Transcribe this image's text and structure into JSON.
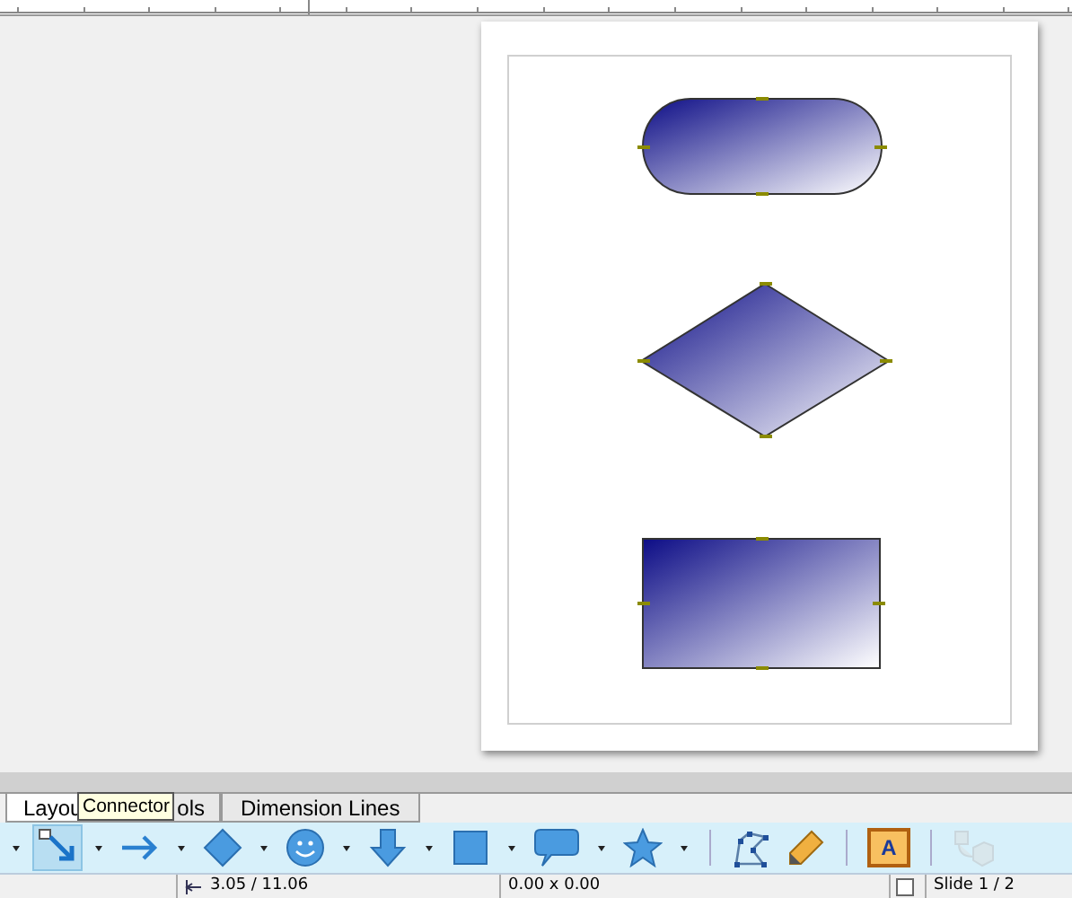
{
  "slide": {
    "shapes": [
      {
        "kind": "rounded"
      },
      {
        "kind": "diamond"
      },
      {
        "kind": "rectangle"
      }
    ]
  },
  "tabs": [
    {
      "label": "Layou",
      "selected": true
    },
    {
      "label": "ols",
      "selected": false
    },
    {
      "label": "Dimension Lines",
      "selected": false
    }
  ],
  "tooltip": "Connector",
  "toolbar": [
    {
      "kind": "connector",
      "selected": true,
      "disabled": false,
      "dropdown": true
    },
    {
      "kind": "arrow",
      "selected": false,
      "disabled": false,
      "dropdown": true
    },
    {
      "kind": "diamond",
      "selected": false,
      "disabled": false,
      "dropdown": true
    },
    {
      "kind": "smiley",
      "selected": false,
      "disabled": false,
      "dropdown": true
    },
    {
      "kind": "down-arrow",
      "selected": false,
      "disabled": false,
      "dropdown": true
    },
    {
      "kind": "square",
      "selected": false,
      "disabled": false,
      "dropdown": true
    },
    {
      "kind": "callout",
      "selected": false,
      "disabled": false,
      "dropdown": true
    },
    {
      "kind": "star",
      "selected": false,
      "disabled": false,
      "dropdown": true
    },
    {
      "kind": "separator"
    },
    {
      "kind": "polygon",
      "selected": false,
      "disabled": false,
      "dropdown": false
    },
    {
      "kind": "pencil",
      "selected": false,
      "disabled": false,
      "dropdown": false
    },
    {
      "kind": "separator"
    },
    {
      "kind": "text-frame",
      "label": "A",
      "selected": false,
      "disabled": false,
      "dropdown": false
    },
    {
      "kind": "separator"
    },
    {
      "kind": "extrusion",
      "selected": false,
      "disabled": true,
      "dropdown": false
    }
  ],
  "status_bar": {
    "position": "3.05 / 11.06",
    "size": "0.00 x 0.00",
    "slide": "Slide 1 / 2"
  }
}
